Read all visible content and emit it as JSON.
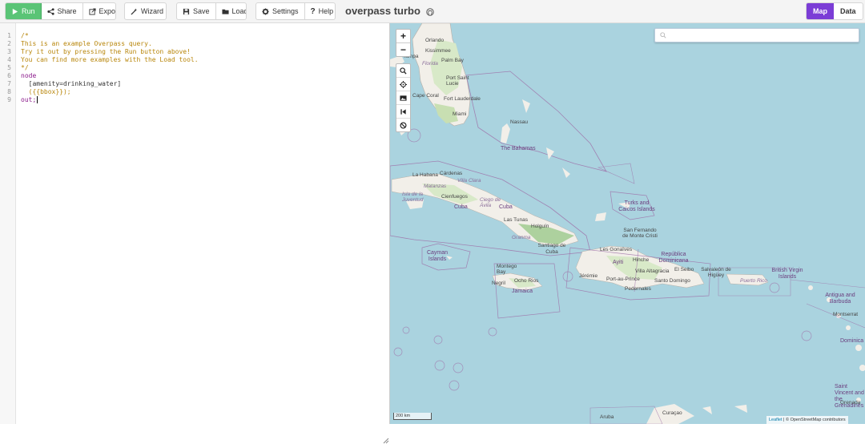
{
  "toolbar": {
    "run_label": "Run",
    "share_label": "Share",
    "export_label": "Export",
    "wizard_label": "Wizard",
    "save_label": "Save",
    "load_label": "Load",
    "settings_label": "Settings",
    "help_label": "Help"
  },
  "app": {
    "title": "overpass turbo"
  },
  "view_tabs": {
    "map_label": "Map",
    "data_label": "Data",
    "active": "Map"
  },
  "editor": {
    "line_numbers": [
      "1",
      "2",
      "3",
      "4",
      "5",
      "6",
      "7",
      "8",
      "9"
    ],
    "lines": [
      "/*",
      "This is an example Overpass query.",
      "Try it out by pressing the Run button above!",
      "You can find more examples with the Load tool.",
      "*/",
      "node",
      "  [amenity=drinking_water]",
      "  ({{bbox}});",
      "out;"
    ]
  },
  "map": {
    "scale_label": "200 km",
    "attribution_leaflet": "Leaflet",
    "attribution_rest": "| © OpenStreetMap contributors",
    "labels": {
      "orlando": "Orlando",
      "kissimmee": "Kissimmee",
      "tampa": "Tampa",
      "florida": "Florida",
      "palm_bay": "Palm Bay",
      "port_saint_lucie": "Port Saint Lucie",
      "cape_coral": "Cape Coral",
      "fort_lauderdale": "Fort Lauderdale",
      "miami": "Miami",
      "nassau": "Nassau",
      "bahamas": "The Bahamas",
      "la_habana": "La Habana",
      "cardenas": "Cárdenas",
      "villa_clara": "Villa Clara",
      "matanzas": "Matanzas",
      "cienfuegos": "Cienfuegos",
      "isla_juventud": "Isla de la Juventud",
      "ciego": "Ciego de Ávila",
      "cuba": "Cuba",
      "las_tunas": "Las Tunas",
      "holguin": "Holguín",
      "granma": "Granma",
      "santiago": "Santiago de Cuba",
      "turks": "Turks and Caicos Islands",
      "cayman": "Cayman Islands",
      "san_fernando": "San Fernando de Monte Cristi",
      "les_gonaives": "Les Gonaïves",
      "ayiti": "Ayiti",
      "hinche": "Hinche",
      "villa_altagracia": "Villa Altagracia",
      "republica": "República Dominicana",
      "el_seibo": "El Seibo",
      "salvaleon": "Salvaleón de Higüey",
      "jeremie": "Jérémie",
      "port_au_prince": "Port-au-Prince",
      "santo_domingo": "Santo Domingo",
      "pedernales": "Pedernales",
      "montego": "Montego Bay",
      "negril": "Negril",
      "ocho_rios": "Ocho Rios",
      "jamaica": "Jamaica",
      "puerto_rico": "Puerto Rico",
      "bvi": "British Virgin Islands",
      "antigua": "Antigua and Barbuda",
      "montserrat": "Montserrat",
      "dominica": "Dominica",
      "saint_vincent": "Saint Vincent and the Grenadines",
      "grenada": "Grenada",
      "curacao": "Curaçao",
      "aruba": "Aruba"
    }
  },
  "colors": {
    "run_green": "#5ac476",
    "map_tab_purple": "#7b3dd6",
    "sea": "#aad3df",
    "land": "#f2efe9",
    "forest": "#add19e",
    "border": "#9e6fa8"
  }
}
